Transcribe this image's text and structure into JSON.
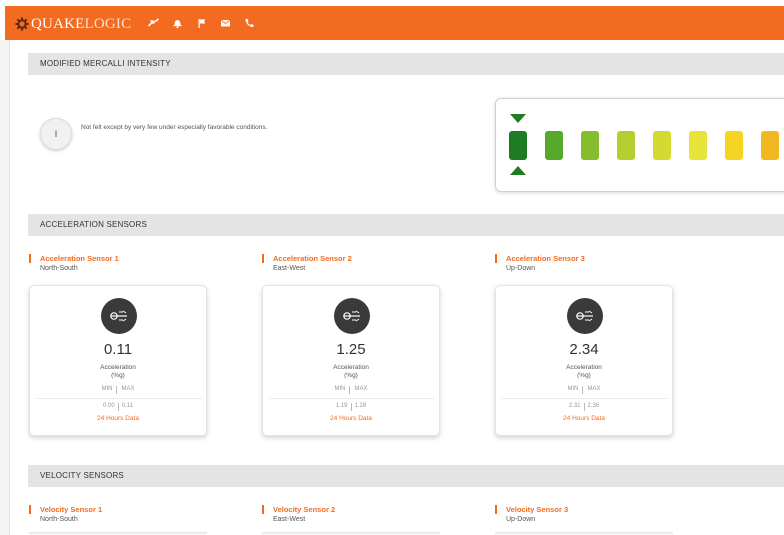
{
  "header": {
    "brand_primary": "QUAKE",
    "brand_secondary": "LOGIC",
    "bar_color": "#f26b21",
    "icons": [
      "share-icon",
      "bell-icon",
      "flag-icon",
      "mail-icon",
      "phone-icon"
    ]
  },
  "mmi": {
    "section_title": "MODIFIED MERCALLI INTENSITY",
    "current_level": "I",
    "description": "Not felt except by very few under especially favorable conditions.",
    "selected_index": 0,
    "scale_colors": [
      "#1e7d23",
      "#55a82a",
      "#86bd2e",
      "#b4ce2f",
      "#d4da32",
      "#e8e33a",
      "#f5d423",
      "#f2b822"
    ]
  },
  "acceleration": {
    "section_title": "ACCELERATION SENSORS",
    "sensors": [
      {
        "name": "Acceleration Sensor 1",
        "axis": "North-South",
        "value": "0.11",
        "metric": "Acceleration",
        "unit": "(%g)",
        "min_label": "MIN",
        "max_label": "MAX",
        "min": "0.00",
        "max": "0.11",
        "link": "24 Hours Data"
      },
      {
        "name": "Acceleration Sensor 2",
        "axis": "East-West",
        "value": "1.25",
        "metric": "Acceleration",
        "unit": "(%g)",
        "min_label": "MIN",
        "max_label": "MAX",
        "min": "1.19",
        "max": "1.28",
        "link": "24 Hours Data"
      },
      {
        "name": "Acceleration Sensor 3",
        "axis": "Up-Down",
        "value": "2.34",
        "metric": "Acceleration",
        "unit": "(%g)",
        "min_label": "MIN",
        "max_label": "MAX",
        "min": "2.31",
        "max": "2.36",
        "link": "24 Hours Data"
      }
    ]
  },
  "velocity": {
    "section_title": "VELOCITY SENSORS",
    "sensors": [
      {
        "name": "Velocity Sensor 1",
        "axis": "North-South"
      },
      {
        "name": "Velocity Sensor 2",
        "axis": "East-West"
      },
      {
        "name": "Velocity Sensor 3",
        "axis": "Up-Down"
      }
    ]
  }
}
